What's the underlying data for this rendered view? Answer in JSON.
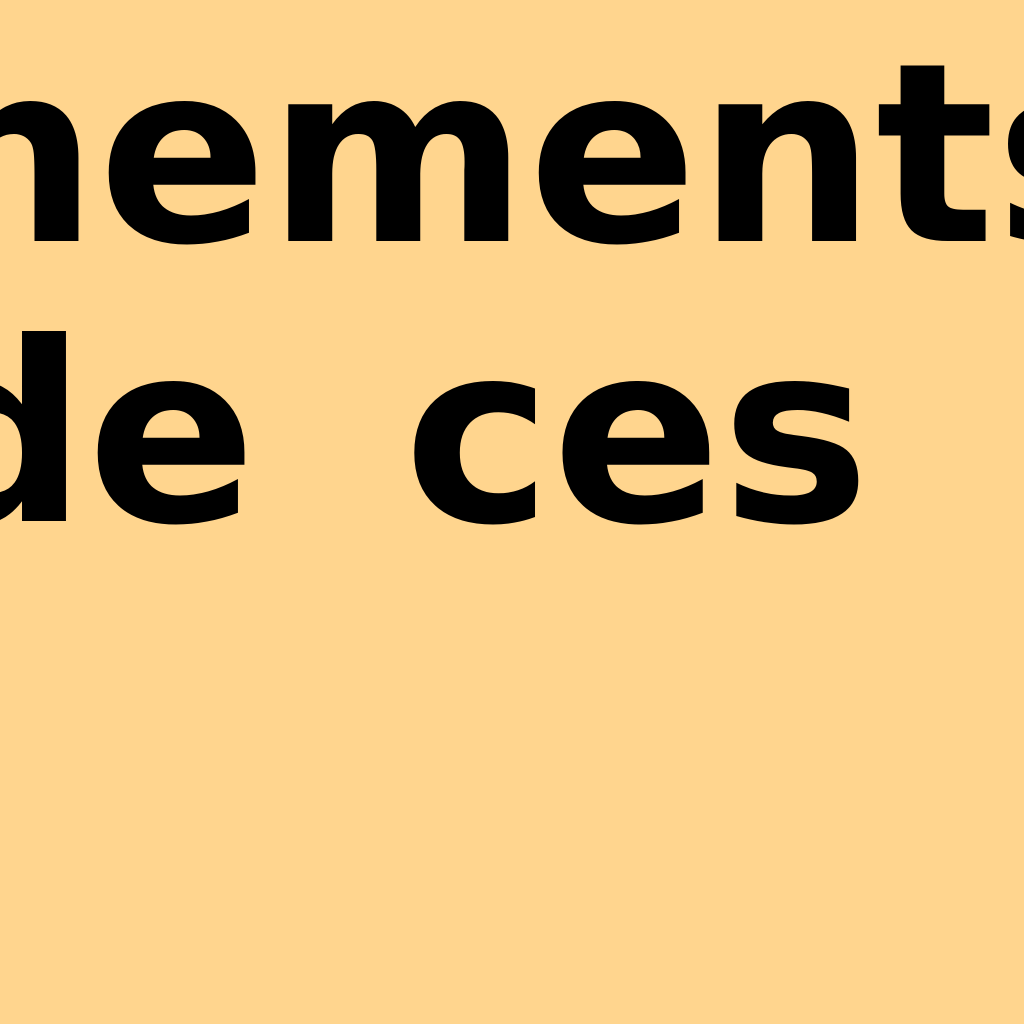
{
  "text": {
    "line_1": "nements",
    "line_2": "de ces b"
  },
  "colors": {
    "background": "#ffd58e",
    "text": "#000000"
  }
}
